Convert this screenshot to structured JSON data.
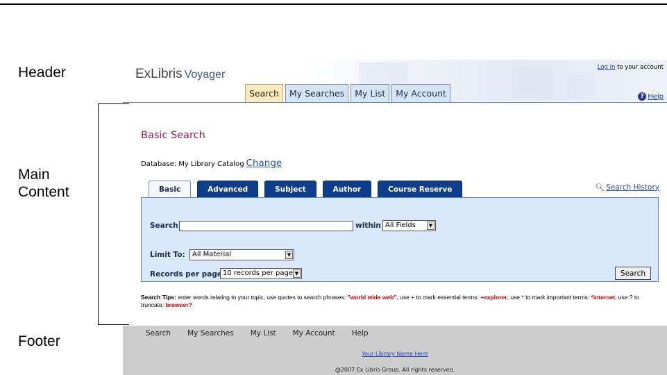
{
  "labels": {
    "header": "Header",
    "main_content_1": "Main",
    "main_content_2": "Content",
    "footer": "Footer"
  },
  "header": {
    "logo_exlibris": "ExLibris",
    "logo_voyager": "Voyager",
    "login_link": "Log in",
    "login_rest": " to your account",
    "help": "Help",
    "tabs": [
      "Search",
      "My Searches",
      "My List",
      "My Account"
    ]
  },
  "main": {
    "title": "Basic Search",
    "database_label": "Database: My Library Catalog",
    "database_change": "Change",
    "search_history": "Search History",
    "sub_tabs": [
      "Basic",
      "Advanced",
      "Subject",
      "Author",
      "Course Reserve"
    ],
    "search_label": "Search:",
    "search_value": "",
    "within_label": "within",
    "within_value": "All Fields",
    "limit_label": "Limit To:",
    "limit_value": "All Material",
    "records_label": "Records per page:",
    "records_value": "10 records per page",
    "search_button": "Search"
  },
  "tips": {
    "label": "Search Tips:",
    "t1": " enter words relating to your topic, use quotes to search phrases: ",
    "ex1": "\"world wide web\"",
    "t2": ", use + to mark essential terms: ",
    "ex2": "+explorer",
    "t3": ", use * to mark important terms: ",
    "ex3": "*internet",
    "t4": ", use ? to truncate: ",
    "ex4": "browser?"
  },
  "footer": {
    "nav": [
      "Search",
      "My Searches",
      "My List",
      "My Account",
      "Help"
    ],
    "library_name": "Your Library Name Here",
    "copyright": "@2007 Ex Libris Group. All rights reserved."
  },
  "colors": {
    "title": "#8e1f4e",
    "tab_active_bg": "#fbe9bf",
    "sub_tab_bg": "#0e3d8a",
    "panel_bg": "#d9e9fb",
    "footer_bg": "#cdcdcd",
    "link": "#1a3fbf"
  }
}
